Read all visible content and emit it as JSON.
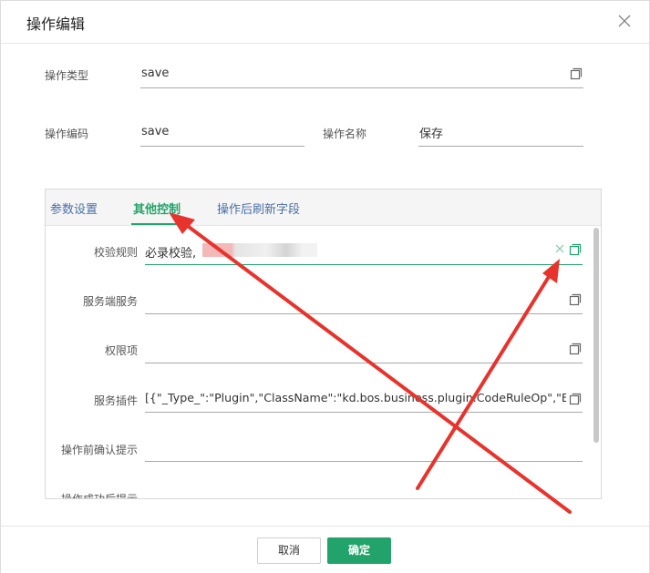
{
  "dialog": {
    "title": "操作编辑"
  },
  "form": {
    "type_label": "操作类型",
    "type_value": "save",
    "code_label": "操作编码",
    "code_value": "save",
    "name_label": "操作名称",
    "name_value": "保存"
  },
  "tabs": [
    {
      "label": "参数设置"
    },
    {
      "label": "其他控制"
    },
    {
      "label": "操作后刷新字段"
    }
  ],
  "active_tab": "其他控制",
  "rows": [
    {
      "label": "校验规则",
      "value": "必录校验,"
    },
    {
      "label": "服务端服务",
      "value": ""
    },
    {
      "label": "权限项",
      "value": ""
    },
    {
      "label": "服务插件",
      "value": "[{\"_Type_\":\"Plugin\",\"ClassName\":\"kd.bos.business.plugin.CodeRuleOp\",\"E"
    },
    {
      "label": "操作前确认提示",
      "value": ""
    },
    {
      "label": "操作成功后提示",
      "value": ""
    }
  ],
  "footer": {
    "cancel_label": "取消",
    "ok_label": "确定"
  },
  "colors": {
    "accent": "#22a36b",
    "tab_link": "#4a6fa5",
    "annotation_arrow": "#e8332d"
  },
  "icons": [
    "close-icon",
    "copy-icon",
    "clear-icon"
  ]
}
